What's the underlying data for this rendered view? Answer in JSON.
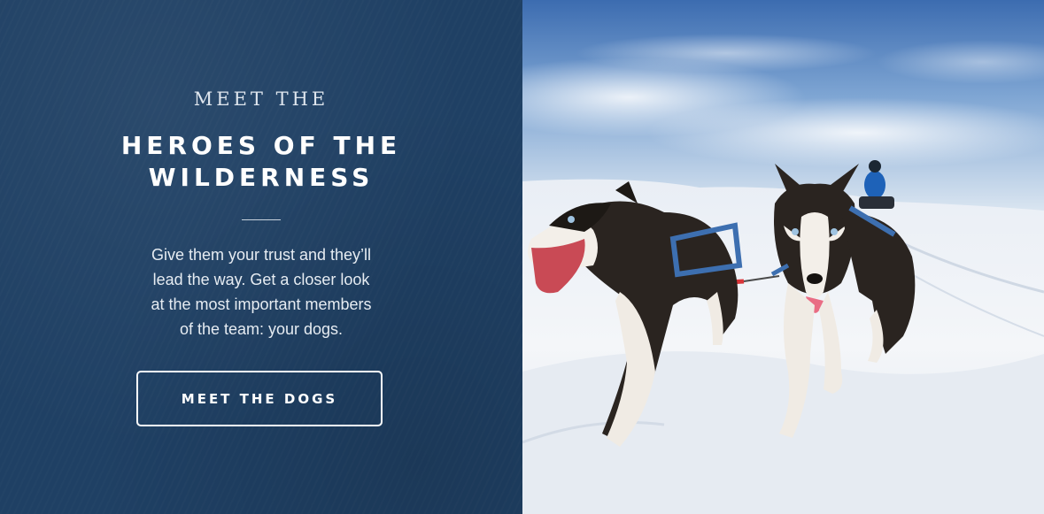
{
  "hero": {
    "eyebrow": "MEET THE",
    "title_line1": "HEROES OF THE",
    "title_line2": "WILDERNESS",
    "body_lines": [
      "Give them your trust and they’ll",
      "lead the way. Get a closer look",
      "at the most important members",
      "of the team: your dogs."
    ],
    "cta_label": "MEET THE DOGS"
  },
  "photo": {
    "subject": "sled-dogs-photo",
    "colors": {
      "panel_bg": "#1f4064",
      "sky_top": "#3f72b6",
      "snow": "#f1f4f8",
      "harness": "#3d6fb0",
      "tug_line": "#d9363a"
    }
  }
}
